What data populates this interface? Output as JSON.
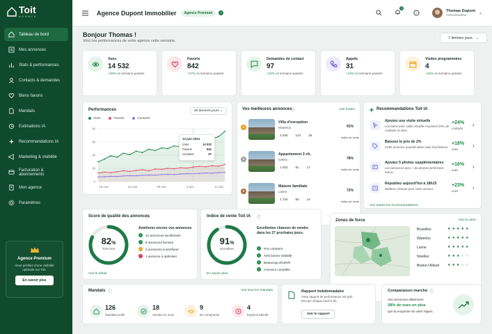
{
  "brand": {
    "name": "Toit",
    "sub": "AGENCE"
  },
  "nav": [
    {
      "label": "Tableau de bord",
      "icon": "home-icon"
    },
    {
      "label": "Mes annonces",
      "icon": "listing-icon"
    },
    {
      "label": "Stats & performances",
      "icon": "chart-icon"
    },
    {
      "label": "Contacts & demandes",
      "icon": "contacts-icon"
    },
    {
      "label": "Biens favoris",
      "icon": "heart-icon"
    },
    {
      "label": "Mandats",
      "icon": "document-icon"
    },
    {
      "label": "Estimations IA",
      "icon": "estimate-icon"
    },
    {
      "label": "Recommandations IA",
      "icon": "sparkle-icon"
    },
    {
      "label": "Marketing & visibilité",
      "icon": "megaphone-icon"
    },
    {
      "label": "Facturation & abonnements",
      "icon": "card-icon"
    },
    {
      "label": "Mon agence",
      "icon": "building-icon"
    },
    {
      "label": "Paramètres",
      "icon": "gear-icon"
    }
  ],
  "premium": {
    "title": "Agence Premium",
    "desc": "Vous profitez d'une visibilité optimale sur Toit.",
    "button": "En savoir plus"
  },
  "topbar": {
    "agency": "Agence Dupont Immobilier",
    "pill": "Agence Premium",
    "notif_count": "3",
    "user_name": "Thomas Dupont",
    "user_role": "Administrateur"
  },
  "greeting": {
    "title": "Bonjour Thomas !",
    "subtitle": "Voici les performances de votre agence cette semaine.",
    "period": "7 derniers jours"
  },
  "kpis": [
    {
      "label": "Vues",
      "value": "14 532",
      "delta": "+38%",
      "delta_text": "vs semaine passée",
      "color": "#1e8a4a",
      "bg": "#e4f4ea"
    },
    {
      "label": "Favoris",
      "value": "842",
      "delta": "+27%",
      "delta_text": "vs semaine passée",
      "color": "#d6334a",
      "bg": "#fde7ea"
    },
    {
      "label": "Demandes de contact",
      "value": "97",
      "delta": "+42%",
      "delta_text": "vs semaine passée",
      "color": "#2a8c4e",
      "bg": "#e4f4ea"
    },
    {
      "label": "Appels",
      "value": "31",
      "delta": "+19%",
      "delta_text": "vs semaine passée",
      "color": "#6c57d6",
      "bg": "#eeeafc"
    },
    {
      "label": "Visites programmées",
      "value": "4",
      "delta": "+33%",
      "delta_text": "vs semaine passée",
      "color": "#e8a21a",
      "bg": "#fdf3dd"
    }
  ],
  "performances": {
    "title": "Performances",
    "select": "30 derniers jours",
    "tooltip": {
      "date": "12 juin 2024",
      "rows": [
        {
          "label": "Vues",
          "value": "14 532"
        },
        {
          "label": "Favoris",
          "value": "842"
        },
        {
          "label": "Contacts",
          "value": "97"
        }
      ]
    }
  },
  "chart_data": {
    "type": "line",
    "x": [
      "15 mai",
      "22 mai",
      "29 mai",
      "5 juin",
      "12 juin"
    ],
    "yticks": [
      "0",
      "2k",
      "4k",
      "6k",
      "8k"
    ],
    "ylim": [
      0,
      8000
    ],
    "series": [
      {
        "name": "Vues",
        "color": "#1e8a4a",
        "values": [
          3000,
          3400,
          3900,
          3700,
          4300,
          4100,
          4600,
          4400,
          4900,
          4700,
          5100,
          5000,
          5400,
          5300,
          5800,
          5600,
          6100,
          6000,
          6500,
          6800,
          7600
        ]
      },
      {
        "name": "Favoris",
        "color": "#e0566a",
        "values": [
          1300,
          1450,
          1350,
          1500,
          1650,
          1550,
          1700,
          1800,
          1650,
          1900,
          1850,
          2000,
          1950,
          2100,
          2050,
          2200,
          2300,
          2250,
          2400,
          2350,
          2600
        ]
      },
      {
        "name": "Contacts",
        "color": "#8c7ae6",
        "values": [
          700,
          750,
          800,
          780,
          850,
          900,
          880,
          950,
          1000,
          980,
          1050,
          1100,
          1080,
          1150,
          1200,
          1180,
          1250,
          1300,
          1280,
          1350,
          1400
        ]
      }
    ]
  },
  "best": {
    "title": "Vos meilleures annonces",
    "link": "Voir toutes",
    "items": [
      {
        "rank": "1",
        "rank_color": "#e8a21a",
        "title": "Villa d'exception",
        "city": "Waterloo",
        "views": "2 845",
        "fav": "143",
        "contacts": "28",
        "score": "91%",
        "score_value": 91,
        "score_label": "Indice de vente"
      },
      {
        "rank": "2",
        "rank_color": "#9aa3a0",
        "title": "Appartement 3 ch.",
        "city": "Ixelles",
        "views": "1 932",
        "fav": "91",
        "contacts": "17",
        "score": "78%",
        "score_value": 78,
        "score_label": "Indice de vente"
      },
      {
        "rank": "3",
        "rank_color": "#b06a3a",
        "title": "Maison familiale",
        "city": "Lasne",
        "views": "1 725",
        "fav": "80",
        "contacts": "14",
        "score": "72%",
        "score_value": 72,
        "score_label": "Indice de vente"
      }
    ]
  },
  "reco": {
    "title": "Recommandations Toit IA",
    "link": "Voir toutes les recommandations",
    "items": [
      {
        "title": "Ajoutez une visite virtuelle",
        "desc": "Les biens avec visite virtuelle reçoivent 34% de contacts en plus.",
        "value": "+24%",
        "unit": "contacts"
      },
      {
        "title": "Baissez le prix de 2%",
        "desc": "Cette annonce pourrait attirer plus d'acheteurs.",
        "value": "+18%",
        "unit": "vues"
      },
      {
        "title": "Ajoutez 5 photos supplémentaires",
        "desc": "Les annonces avec + de photos performent mieux.",
        "value": "+16%",
        "unit": "vues"
      },
      {
        "title": "Republiez aujourd'hui à 18h15",
        "desc": "Meilleur créneau pour votre secteur.",
        "value": "+23%",
        "unit": "vues"
      }
    ]
  },
  "quality": {
    "title": "Score de qualité des annonces",
    "score": "82",
    "pct": "%",
    "score_value": 82,
    "label": "Très bon",
    "improve_title": "Améliorez encore vos annonces",
    "items": [
      {
        "text": "12 annonces excellentes",
        "color": "#1e8a4a"
      },
      {
        "text": "8 annonces bonnes",
        "color": "#1e8a4a"
      },
      {
        "text": "3 annonces à améliorer",
        "color": "#e8a21a"
      },
      {
        "text": "1 annonce à optimiser",
        "color": "#d6334a"
      }
    ],
    "link": "Voir le détail"
  },
  "index": {
    "title": "Indice de vente Toit IA",
    "score": "91",
    "pct": "%",
    "score_value": 91,
    "label": "Excellent",
    "desc": "Excellentes chances de vendre dans les 27 prochains jours.",
    "items": [
      "Prix cohérent",
      "Très bonne visibilité",
      "Beaucoup d'intérêt",
      "Annonce complète"
    ],
    "link": "En savoir plus"
  },
  "zones": {
    "title": "Zones de force",
    "link": "Voir la carte",
    "items": [
      {
        "name": "Bruxelles",
        "stars": 5
      },
      {
        "name": "Waterloo",
        "stars": 5
      },
      {
        "name": "Lasne",
        "stars": 5
      },
      {
        "name": "Nivelles",
        "stars": 3
      },
      {
        "name": "Braine-l'Alleud",
        "stars": 3
      }
    ]
  },
  "mandats": {
    "title": "Mandats",
    "link": "Voir tous les mandats",
    "items": [
      {
        "value": "126",
        "label": "Mandats actifs",
        "color": "#1e8a4a",
        "bg": "#e4f4ea",
        "icon": "house-icon"
      },
      {
        "value": "18",
        "label": "Vendus ce mois",
        "color": "#1e8a4a",
        "bg": "#e4f4ea",
        "icon": "check-icon"
      },
      {
        "value": "9",
        "label": "En compromis",
        "color": "#e8a21a",
        "bg": "#fdf3dd",
        "icon": "handshake-icon"
      },
      {
        "value": "4",
        "label": "Expirent bientôt",
        "color": "#d6334a",
        "bg": "#fde7ea",
        "icon": "clock-icon"
      }
    ]
  },
  "report": {
    "title": "Rapport hebdomadaire",
    "desc": "Votre rapport de performance est prêt. Envoyé chaque lundi à 8h.",
    "button": "Voir le rapport"
  },
  "market": {
    "title": "Comparaison marché",
    "line1": "Vos annonces obtiennent",
    "highlight": "28% de vues en plus",
    "line2": "que la moyenne de votre région."
  }
}
